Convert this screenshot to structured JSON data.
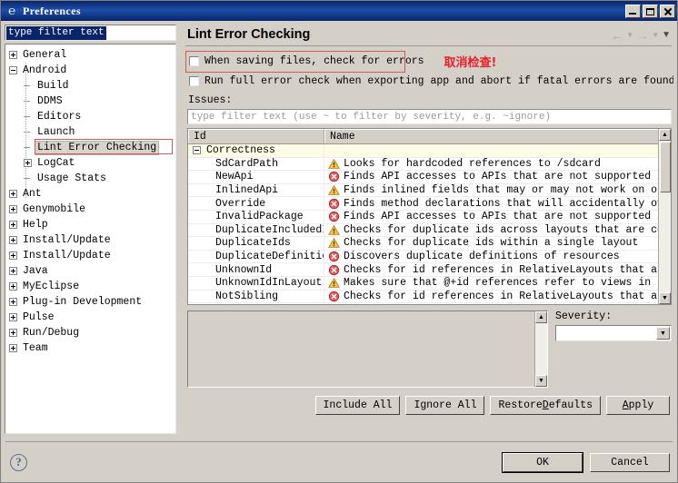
{
  "window": {
    "title": "Preferences",
    "icon": "preferences-icon",
    "controls": {
      "minimize": "minimize-icon",
      "maximize": "maximize-icon",
      "close": "close-icon"
    }
  },
  "sidebar": {
    "filter": {
      "value": "type filter text",
      "selected": true
    },
    "items": [
      {
        "label": "General",
        "level": 0,
        "expander": "plus",
        "selected": false
      },
      {
        "label": "Android",
        "level": 0,
        "expander": "minus",
        "selected": false
      },
      {
        "label": "Build",
        "level": 1,
        "expander": "none",
        "selected": false
      },
      {
        "label": "DDMS",
        "level": 1,
        "expander": "none",
        "selected": false
      },
      {
        "label": "Editors",
        "level": 1,
        "expander": "none",
        "selected": false
      },
      {
        "label": "Launch",
        "level": 1,
        "expander": "none",
        "selected": false
      },
      {
        "label": "Lint Error Checking",
        "level": 1,
        "expander": "none",
        "selected": true
      },
      {
        "label": "LogCat",
        "level": 1,
        "expander": "plus",
        "selected": false
      },
      {
        "label": "Usage Stats",
        "level": 1,
        "expander": "none",
        "selected": false
      },
      {
        "label": "Ant",
        "level": 0,
        "expander": "plus",
        "selected": false
      },
      {
        "label": "Genymobile",
        "level": 0,
        "expander": "plus",
        "selected": false
      },
      {
        "label": "Help",
        "level": 0,
        "expander": "plus",
        "selected": false
      },
      {
        "label": "Install/Update",
        "level": 0,
        "expander": "plus",
        "selected": false
      },
      {
        "label": "Install/Update",
        "level": 0,
        "expander": "plus",
        "selected": false
      },
      {
        "label": "Java",
        "level": 0,
        "expander": "plus",
        "selected": false
      },
      {
        "label": "MyEclipse",
        "level": 0,
        "expander": "plus",
        "selected": false
      },
      {
        "label": "Plug-in Development",
        "level": 0,
        "expander": "plus",
        "selected": false
      },
      {
        "label": "Pulse",
        "level": 0,
        "expander": "plus",
        "selected": false
      },
      {
        "label": "Run/Debug",
        "level": 0,
        "expander": "plus",
        "selected": false
      },
      {
        "label": "Team",
        "level": 0,
        "expander": "plus",
        "selected": false
      }
    ]
  },
  "page": {
    "title": "Lint Error Checking",
    "nav": {
      "back": "back-arrow-icon",
      "back_menu": "chevron-down-icon",
      "forward": "forward-arrow-icon",
      "forward_menu": "chevron-down-icon",
      "view_menu": "view-menu-icon"
    },
    "checkboxes": [
      {
        "label": "When saving files, check for errors",
        "checked": false,
        "annotated": true
      },
      {
        "label": "Run full error check when exporting app and abort if fatal errors are found",
        "checked": false,
        "annotated": false
      }
    ],
    "annotation": {
      "text": "取消检查!",
      "color": "#e8202a",
      "box_color": "#d05b5b"
    },
    "issues": {
      "label": "Issues:",
      "filter_placeholder": "type filter text (use ~ to filter by severity, e.g. ~ignore)",
      "columns": [
        "Id",
        "Name"
      ],
      "rows": [
        {
          "type": "group",
          "id": "Correctness",
          "name": "",
          "severity": ""
        },
        {
          "type": "issue",
          "id": "SdCardPath",
          "name": "Looks for hardcoded references to /sdcard",
          "severity": "warning"
        },
        {
          "type": "issue",
          "id": "NewApi",
          "name": "Finds API accesses to APIs that are not supported in a...",
          "severity": "error"
        },
        {
          "type": "issue",
          "id": "InlinedApi",
          "name": "Finds inlined fields that may or may not work on older...",
          "severity": "warning"
        },
        {
          "type": "issue",
          "id": "Override",
          "name": "Finds method declarations that will accidentally overr...",
          "severity": "error"
        },
        {
          "type": "issue",
          "id": "InvalidPackage",
          "name": "Finds API accesses to APIs that are not supported in A...",
          "severity": "error"
        },
        {
          "type": "issue",
          "id": "DuplicateIncludedI",
          "name": "Checks for duplicate ids across layouts that are combi...",
          "severity": "warning"
        },
        {
          "type": "issue",
          "id": "DuplicateIds",
          "name": "Checks for duplicate ids within a single layout",
          "severity": "warning"
        },
        {
          "type": "issue",
          "id": "DuplicateDefinitic",
          "name": "Discovers duplicate definitions of resources",
          "severity": "error"
        },
        {
          "type": "issue",
          "id": "UnknownId",
          "name": "Checks for id references in RelativeLayouts that are n...",
          "severity": "error"
        },
        {
          "type": "issue",
          "id": "UnknownIdInLayout",
          "name": "Makes sure that @+id references refer to views in the ...",
          "severity": "warning"
        },
        {
          "type": "issue",
          "id": "NotSibling",
          "name": "Checks for id references in RelativeLayouts that are n...",
          "severity": "error"
        }
      ],
      "scrollbar": {
        "up": "scroll-up-icon",
        "down": "scroll-down-icon"
      }
    },
    "description": {
      "text": "",
      "scrollbar": {
        "up": "scroll-up-icon",
        "down": "scroll-down-icon"
      }
    },
    "severity": {
      "label": "Severity:",
      "value": "",
      "arrow": "chevron-down-icon"
    },
    "buttons": {
      "include_all": "Include All",
      "ignore_all": "Ignore All",
      "restore_defaults_pre": "Restore ",
      "restore_defaults_key": "D",
      "restore_defaults_post": "efaults",
      "apply_key": "A",
      "apply_post": "pply"
    }
  },
  "footer": {
    "help": "?",
    "ok": "OK",
    "cancel": "Cancel"
  },
  "colors": {
    "title_bar": "#0a246a",
    "dialog_bg": "#d4d0c8",
    "group_row": "#fcfce4",
    "warning": "#f5b800",
    "error": "#e04a4a",
    "annotation": "#e8202a"
  }
}
